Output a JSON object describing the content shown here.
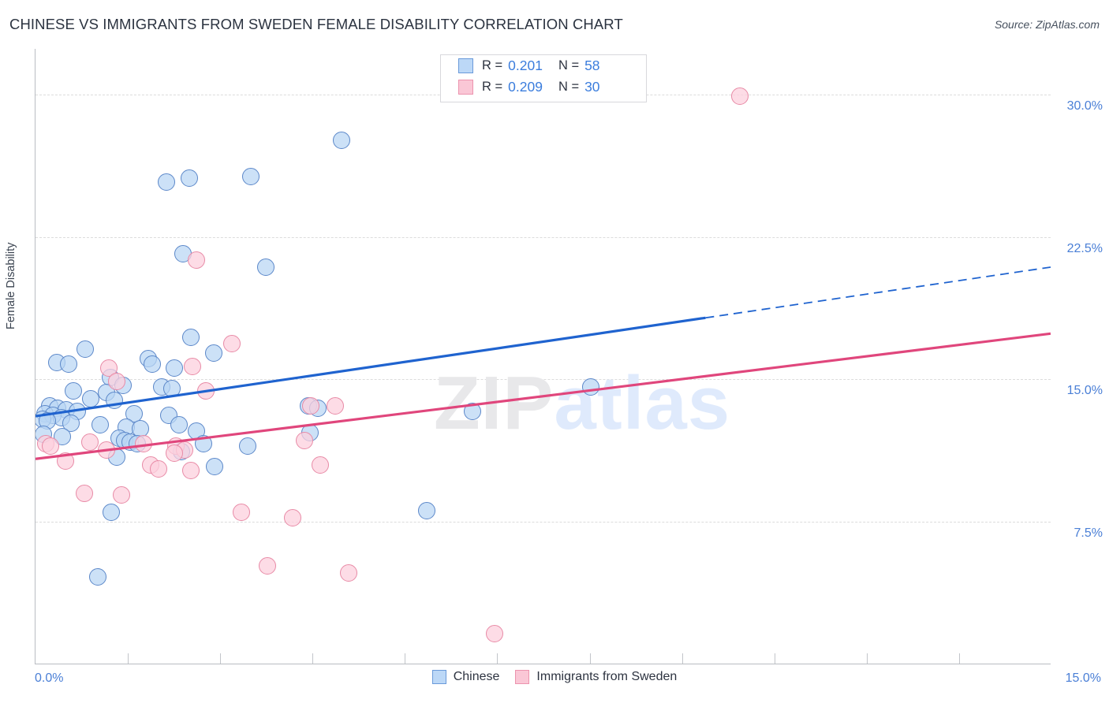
{
  "header": {
    "title": "CHINESE VS IMMIGRANTS FROM SWEDEN FEMALE DISABILITY CORRELATION CHART",
    "source": "Source: ZipAtlas.com"
  },
  "watermark": {
    "part1": "ZIP",
    "part2": "atlas"
  },
  "axes": {
    "y_title": "Female Disability",
    "x_min_label": "0.0%",
    "x_max_label": "15.0%",
    "y_tick_labels": [
      "30.0%",
      "22.5%",
      "15.0%",
      "7.5%"
    ]
  },
  "stats": {
    "rows": [
      {
        "color": "blue",
        "r_label": "R =",
        "r_value": "0.201",
        "n_label": "N =",
        "n_value": "58"
      },
      {
        "color": "pink",
        "r_label": "R =",
        "r_value": "0.209",
        "n_label": "N =",
        "n_value": "30"
      }
    ]
  },
  "legend": {
    "items": [
      {
        "color": "blue",
        "label": "Chinese"
      },
      {
        "color": "pink",
        "label": "Immigrants from Sweden"
      }
    ]
  },
  "colors": {
    "blue_line": "#1f63cf",
    "pink_line": "#e0467c",
    "blue_marker_fill": "#b9d5f4",
    "blue_marker_edge": "#5b87c9",
    "pink_marker_fill": "#fcd0dd",
    "pink_marker_edge": "#e88aa6",
    "tick_label": "#4a7fd6",
    "grid": "#dcdcdc"
  },
  "chart_data": {
    "type": "scatter",
    "title": "CHINESE VS IMMIGRANTS FROM SWEDEN FEMALE DISABILITY CORRELATION CHART",
    "xlabel": "",
    "ylabel": "Female Disability",
    "xlim": [
      0.0,
      15.0
    ],
    "ylim": [
      0.0,
      32.4
    ],
    "xticks": [
      0.0,
      15.0
    ],
    "yticks": [
      7.5,
      15.0,
      22.5,
      30.0
    ],
    "grid": true,
    "legend_position": "bottom-center",
    "series": [
      {
        "name": "Chinese",
        "color": "#b9d5f4",
        "R": 0.201,
        "N": 58,
        "trendline": {
          "x0": 0.0,
          "y0": 13.05,
          "x1": 15.0,
          "y1": 20.9,
          "solid_until_x": 9.9
        },
        "points": [
          [
            4.52,
            27.6
          ],
          [
            1.93,
            25.4
          ],
          [
            2.27,
            25.6
          ],
          [
            3.18,
            25.7
          ],
          [
            2.18,
            21.6
          ],
          [
            3.4,
            20.9
          ],
          [
            2.29,
            17.2
          ],
          [
            2.63,
            16.4
          ],
          [
            0.73,
            16.6
          ],
          [
            1.66,
            16.1
          ],
          [
            0.32,
            15.9
          ],
          [
            0.49,
            15.8
          ],
          [
            1.72,
            15.8
          ],
          [
            2.05,
            15.6
          ],
          [
            1.11,
            15.1
          ],
          [
            1.29,
            14.7
          ],
          [
            1.86,
            14.6
          ],
          [
            2.02,
            14.5
          ],
          [
            0.56,
            14.4
          ],
          [
            1.05,
            14.3
          ],
          [
            0.81,
            14.0
          ],
          [
            1.17,
            13.9
          ],
          [
            0.21,
            13.6
          ],
          [
            0.33,
            13.5
          ],
          [
            0.46,
            13.4
          ],
          [
            0.62,
            13.3
          ],
          [
            0.14,
            13.2
          ],
          [
            0.26,
            13.1
          ],
          [
            0.38,
            13.0
          ],
          [
            1.46,
            13.2
          ],
          [
            1.97,
            13.1
          ],
          [
            4.03,
            13.6
          ],
          [
            4.17,
            13.5
          ],
          [
            6.45,
            13.3
          ],
          [
            8.2,
            14.6
          ],
          [
            0.1,
            12.9
          ],
          [
            0.18,
            12.8
          ],
          [
            0.52,
            12.7
          ],
          [
            0.95,
            12.6
          ],
          [
            1.34,
            12.5
          ],
          [
            1.55,
            12.4
          ],
          [
            2.12,
            12.6
          ],
          [
            2.38,
            12.3
          ],
          [
            4.05,
            12.2
          ],
          [
            0.12,
            12.1
          ],
          [
            0.4,
            12.0
          ],
          [
            1.24,
            11.9
          ],
          [
            1.32,
            11.8
          ],
          [
            1.4,
            11.7
          ],
          [
            1.5,
            11.6
          ],
          [
            2.48,
            11.6
          ],
          [
            3.13,
            11.5
          ],
          [
            1.2,
            10.9
          ],
          [
            2.64,
            10.4
          ],
          [
            1.12,
            8.0
          ],
          [
            5.78,
            8.1
          ],
          [
            0.92,
            4.6
          ],
          [
            2.15,
            11.2
          ]
        ]
      },
      {
        "name": "Immigrants from Sweden",
        "color": "#fcd0dd",
        "R": 0.209,
        "N": 30,
        "trendline": {
          "x0": 0.0,
          "y0": 10.8,
          "x1": 15.0,
          "y1": 17.4,
          "solid_until_x": 15.0
        },
        "points": [
          [
            10.4,
            29.9
          ],
          [
            2.38,
            21.3
          ],
          [
            2.9,
            16.9
          ],
          [
            2.32,
            15.7
          ],
          [
            1.08,
            15.6
          ],
          [
            1.2,
            14.9
          ],
          [
            2.52,
            14.4
          ],
          [
            4.07,
            13.6
          ],
          [
            4.42,
            13.6
          ],
          [
            0.15,
            11.6
          ],
          [
            0.22,
            11.5
          ],
          [
            0.8,
            11.7
          ],
          [
            1.05,
            11.3
          ],
          [
            1.6,
            11.6
          ],
          [
            2.07,
            11.5
          ],
          [
            2.2,
            11.3
          ],
          [
            2.05,
            11.1
          ],
          [
            3.97,
            11.8
          ],
          [
            0.44,
            10.7
          ],
          [
            1.7,
            10.5
          ],
          [
            1.82,
            10.3
          ],
          [
            2.3,
            10.2
          ],
          [
            4.2,
            10.5
          ],
          [
            0.72,
            9.0
          ],
          [
            1.27,
            8.9
          ],
          [
            3.04,
            8.0
          ],
          [
            3.8,
            7.7
          ],
          [
            3.42,
            5.2
          ],
          [
            4.62,
            4.8
          ],
          [
            6.78,
            1.6
          ]
        ]
      }
    ]
  }
}
